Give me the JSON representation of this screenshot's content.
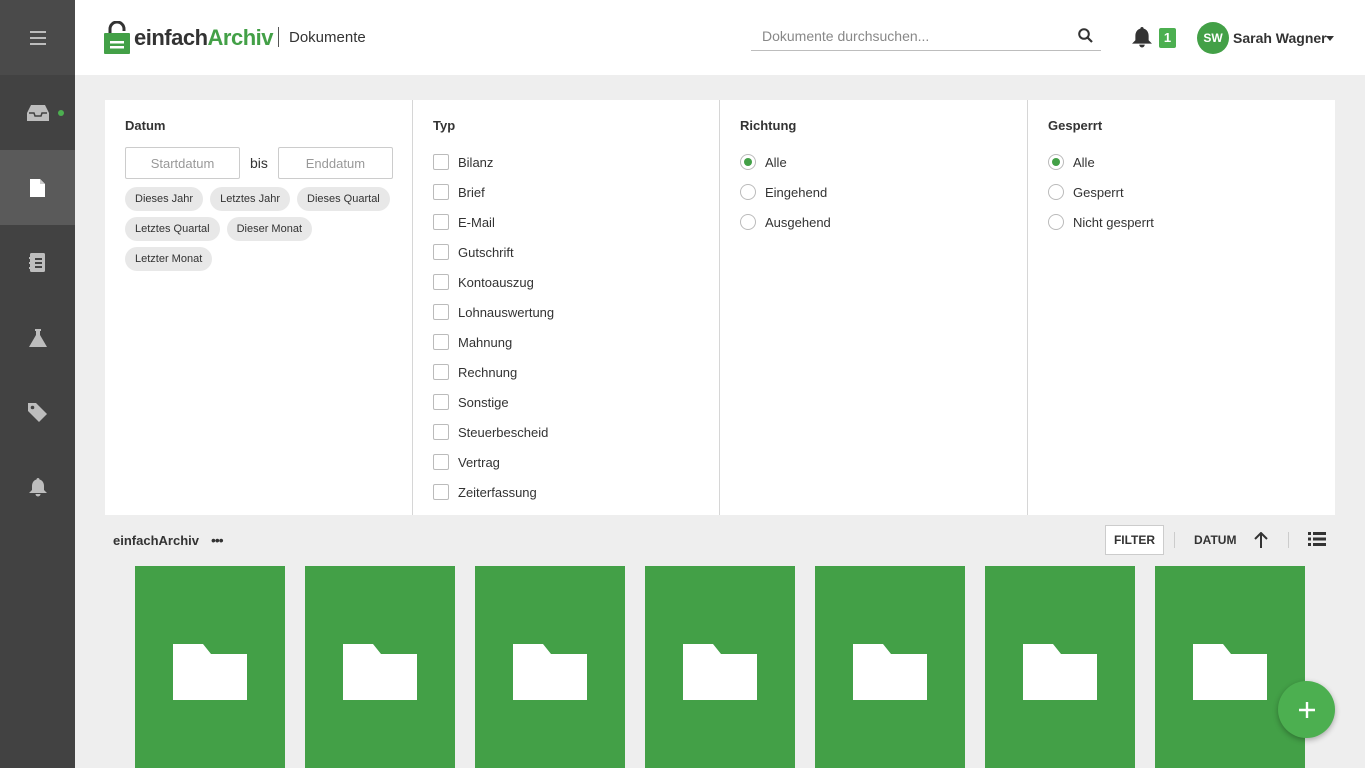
{
  "app": {
    "brand_part1": "einfach",
    "brand_part2": "Archiv",
    "section": "Dokumente"
  },
  "search": {
    "placeholder": "Dokumente durchsuchen..."
  },
  "notifications": {
    "count": "1"
  },
  "user": {
    "initials": "SW",
    "name": "Sarah Wagner"
  },
  "sidebar": {
    "items": [
      {
        "name": "menu",
        "icon": "hamburger-icon"
      },
      {
        "name": "inbox",
        "icon": "inbox-icon",
        "has_indicator": true
      },
      {
        "name": "documents",
        "icon": "document-icon",
        "active": true
      },
      {
        "name": "contacts",
        "icon": "address-book-icon"
      },
      {
        "name": "lab",
        "icon": "flask-icon"
      },
      {
        "name": "tags",
        "icon": "tag-icon"
      },
      {
        "name": "notifications",
        "icon": "bell-icon"
      }
    ]
  },
  "filters": {
    "datum": {
      "title": "Datum",
      "start_placeholder": "Startdatum",
      "bis": "bis",
      "end_placeholder": "Enddatum",
      "chips": [
        "Dieses Jahr",
        "Letztes Jahr",
        "Dieses Quartal",
        "Letztes Quartal",
        "Dieser Monat",
        "Letzter Monat"
      ]
    },
    "typ": {
      "title": "Typ",
      "options": [
        "Bilanz",
        "Brief",
        "E-Mail",
        "Gutschrift",
        "Kontoauszug",
        "Lohnauswertung",
        "Mahnung",
        "Rechnung",
        "Sonstige",
        "Steuerbescheid",
        "Vertrag",
        "Zeiterfassung"
      ]
    },
    "richtung": {
      "title": "Richtung",
      "options": [
        "Alle",
        "Eingehend",
        "Ausgehend"
      ],
      "selected": "Alle"
    },
    "gesperrt": {
      "title": "Gesperrt",
      "options": [
        "Alle",
        "Gesperrt",
        "Nicht gesperrt"
      ],
      "selected": "Alle"
    }
  },
  "toolbar": {
    "breadcrumb": "einfachArchiv",
    "more": "•••",
    "filter_label": "FILTER",
    "sort_label": "DATUM"
  },
  "folders": {
    "count": 7
  },
  "colors": {
    "accent": "#43a047",
    "sidebar": "#424242"
  }
}
